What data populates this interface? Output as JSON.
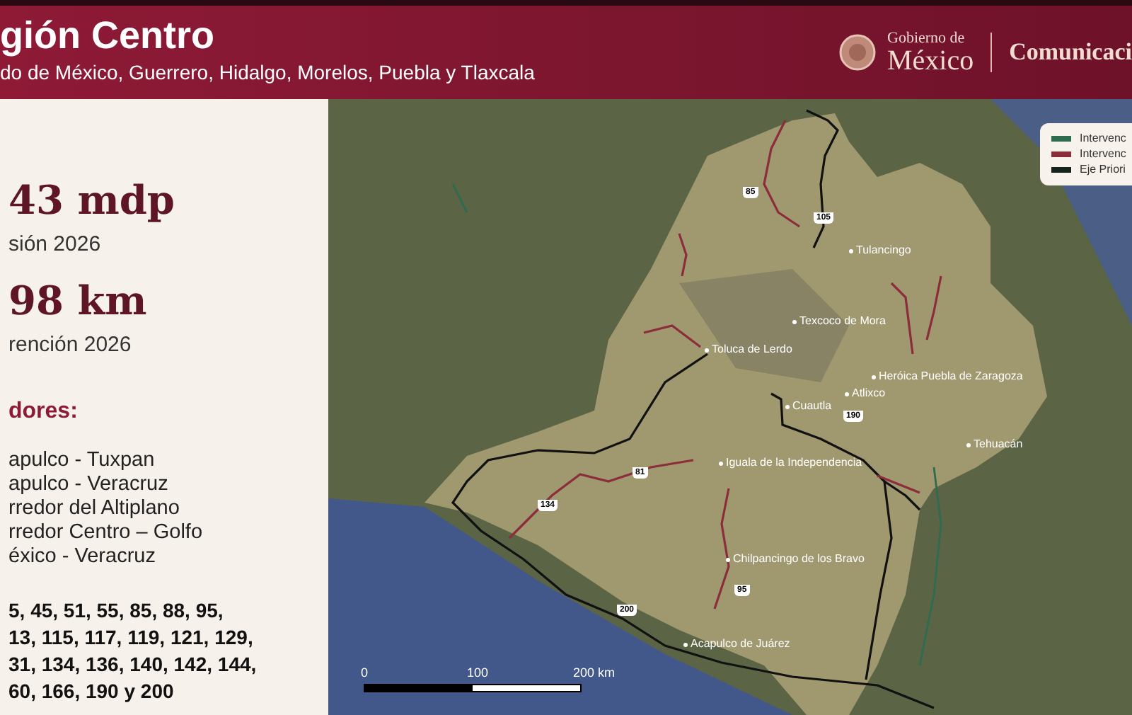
{
  "header": {
    "title": "gión Centro",
    "subtitle": "do de México, Guerrero, Hidalgo, Morelos, Puebla y Tlaxcala",
    "logo": {
      "line1": "Gobierno de",
      "line2": "México"
    },
    "agency": "Comunicaci"
  },
  "summary": {
    "stats": [
      {
        "value": "43 mdp",
        "label": "sión 2026"
      },
      {
        "value": "98 km",
        "label": "rención 2026"
      }
    ],
    "corridors_heading": "dores:",
    "corridors": [
      "apulco - Tuxpan",
      "apulco - Veracruz",
      "rredor del Altiplano",
      "rredor Centro – Golfo",
      "éxico - Veracruz"
    ],
    "highways": [
      "5, 45, 51, 55, 85, 88, 95,",
      "13, 115, 117, 119, 121, 129,",
      "31, 134, 136, 140, 142, 144,",
      "60, 166, 190 y 200"
    ]
  },
  "map": {
    "legend": [
      {
        "label": "Intervenc",
        "color": "#2f6b4f"
      },
      {
        "label": "Intervenc",
        "color": "#8b2d3a"
      },
      {
        "label": "Eje Priori",
        "color": "#15231c"
      }
    ],
    "cities": [
      {
        "name": "Tulancingo"
      },
      {
        "name": "Texcoco de Mora"
      },
      {
        "name": "Toluca de Lerdo"
      },
      {
        "name": "Heróica Puebla de Zaragoza"
      },
      {
        "name": "Atlixco"
      },
      {
        "name": "Cuautla"
      },
      {
        "name": "Tehuacán"
      },
      {
        "name": "Iguala de la Independencia"
      },
      {
        "name": "Chilpancingo de los Bravo"
      },
      {
        "name": "Acapulco de Juárez"
      }
    ],
    "shields": [
      {
        "number": "85"
      },
      {
        "number": "105"
      },
      {
        "number": "190"
      },
      {
        "number": "81"
      },
      {
        "number": "134"
      },
      {
        "number": "95"
      },
      {
        "number": "200"
      }
    ],
    "scale": {
      "labels": [
        "0",
        "100",
        "200 km"
      ]
    }
  }
}
